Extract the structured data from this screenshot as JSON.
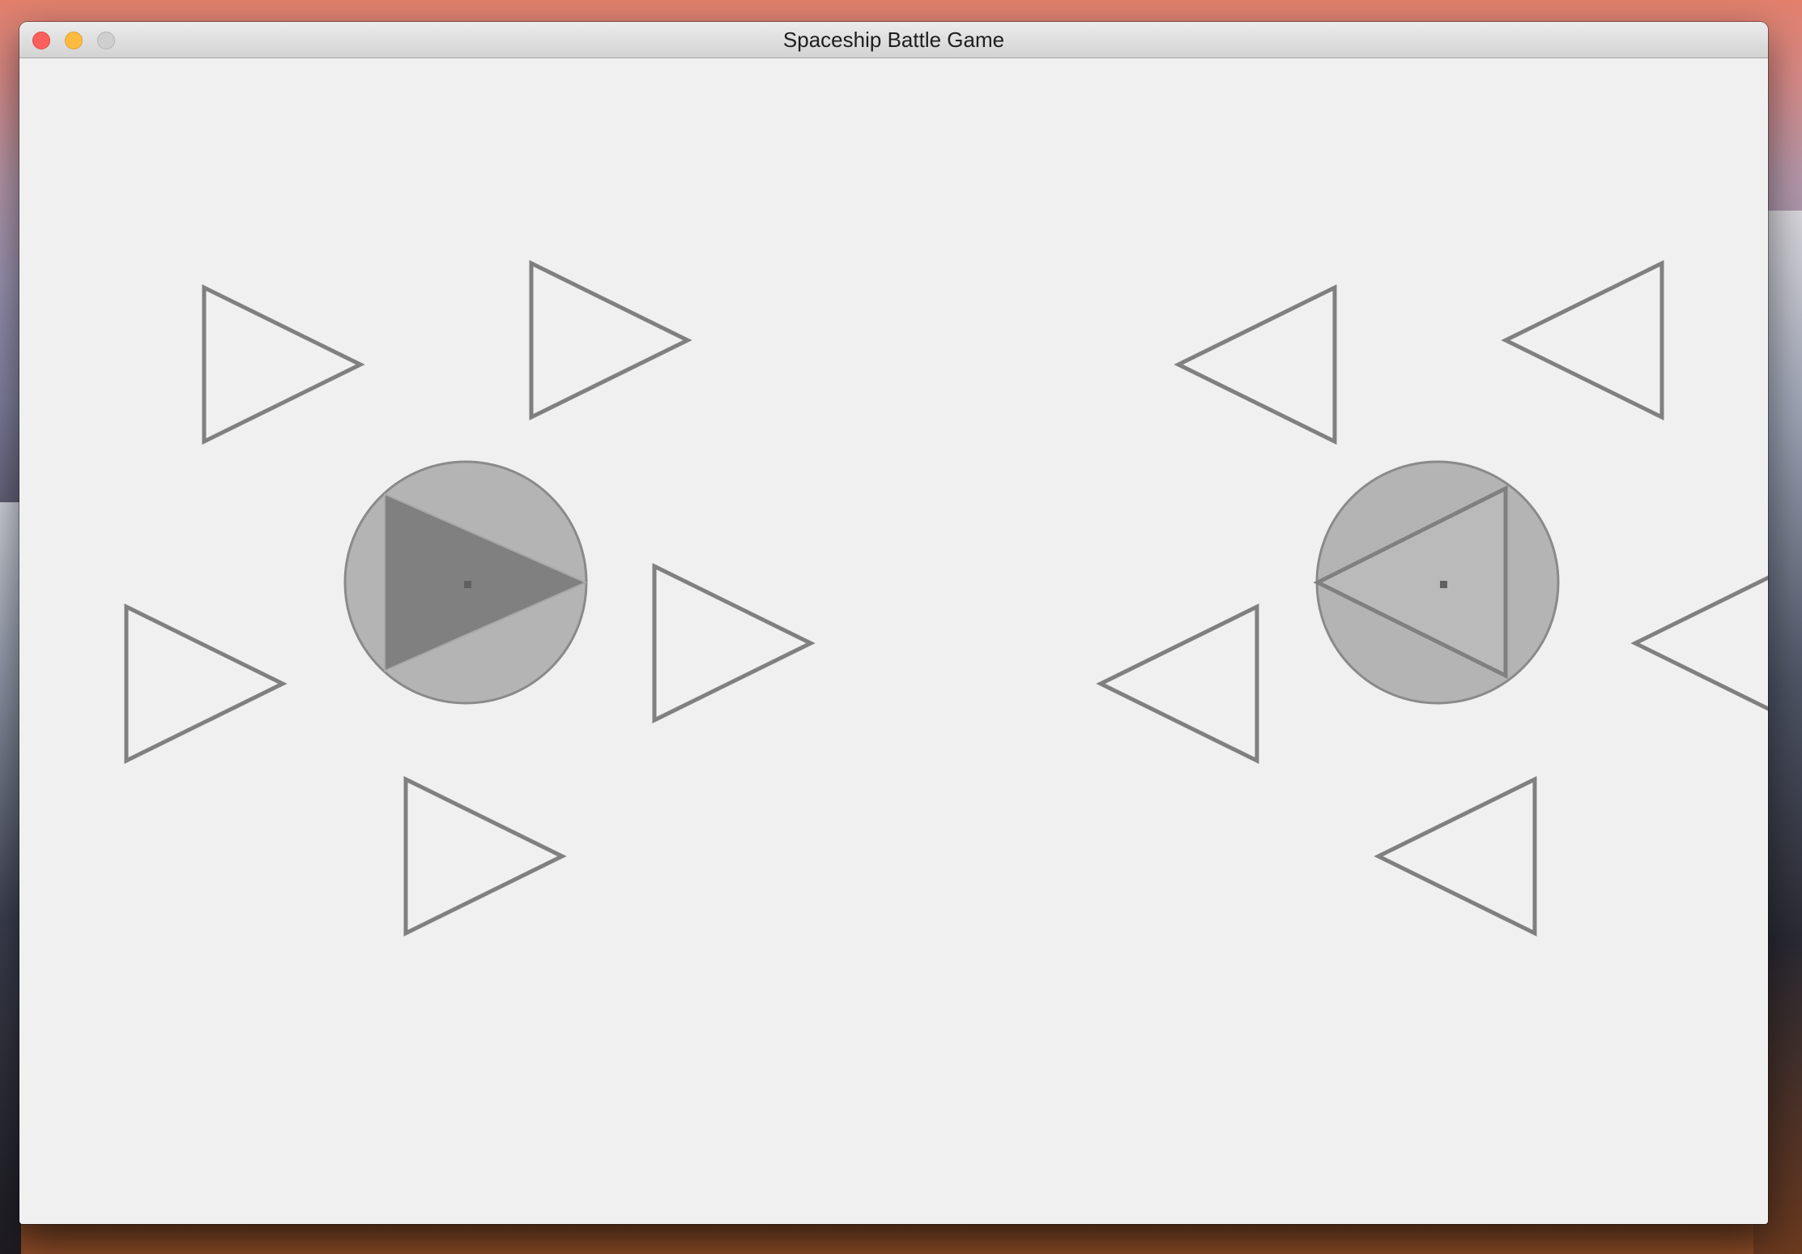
{
  "window": {
    "title": "Spaceship Battle Game"
  },
  "colors": {
    "canvas_background": "#f0f0f0",
    "ship_outline": "#808080",
    "selection_circle": "#b4b4b4",
    "player_one_ship_fill": "#808080"
  },
  "game": {
    "player_one": {
      "facing": "right",
      "active_ship": "filled triangle inside grey selection circle",
      "fleet_size": 5
    },
    "player_two": {
      "facing": "left",
      "active_ship": "outlined triangle inside grey selection circle",
      "fleet_size": 5
    }
  }
}
